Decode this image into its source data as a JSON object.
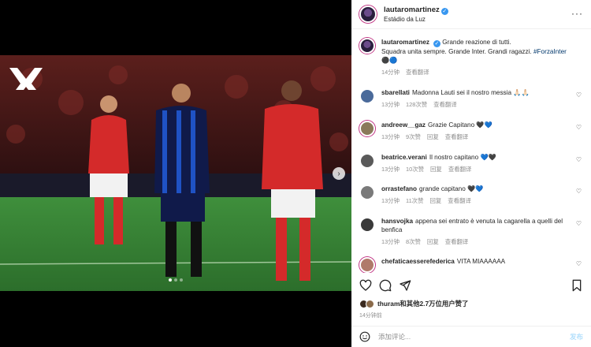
{
  "post": {
    "username": "lautaromartinez",
    "location": "Estádio da Luz",
    "caption_line1": "Grande reazione di tutti.",
    "caption_line2": "Squadra unita sempre. Grande Inter. Grandi ragazzi.",
    "hashtag": "#ForzaInter",
    "caption_emoji": "⚫🔵",
    "caption_time": "14分钟",
    "caption_translate": "查看翻译"
  },
  "comments": [
    {
      "user": "sbarellati",
      "text": "Madonna Lauti sei il nostro messia 🙏🏻🙏🏻",
      "time": "13分钟",
      "likes": "128次赞",
      "reply": "",
      "translate": "查看翻译"
    },
    {
      "user": "andreew__gaz",
      "text": "Grazie Capitano 🖤💙",
      "time": "13分钟",
      "likes": "9次赞",
      "reply": "回复",
      "translate": "查看翻译"
    },
    {
      "user": "beatrice.verani",
      "text": "Il nostro capitano 💙🖤",
      "time": "13分钟",
      "likes": "10次赞",
      "reply": "回复",
      "translate": "查看翻译"
    },
    {
      "user": "orrastefano",
      "text": "grande capitano 🖤💙",
      "time": "13分钟",
      "likes": "11次赞",
      "reply": "回复",
      "translate": "查看翻译"
    },
    {
      "user": "hansvojka",
      "text": "appena sei entrato è venuta la cagarella a quelli del benfica",
      "time": "13分钟",
      "likes": "8次赞",
      "reply": "回复",
      "translate": "查看翻译"
    },
    {
      "user": "chefaticaesserefederica",
      "text": "VITA MIAAAAAA",
      "time": "",
      "likes": "",
      "reply": "",
      "translate": ""
    }
  ],
  "likes_summary": "thuram和其他2.7万位用户赞了",
  "post_time": "14分钟前",
  "comment_box": {
    "placeholder": "添加评论...",
    "post_label": "发布"
  },
  "colors": {
    "link": "#00376b",
    "meta": "#8e8e8e",
    "verified": "#3897f0",
    "post_button": "#b2dffc"
  },
  "icons": [
    "heart-icon",
    "comment-icon",
    "share-icon",
    "save-icon",
    "emoji-icon",
    "more-icon",
    "chevron-right-icon"
  ]
}
